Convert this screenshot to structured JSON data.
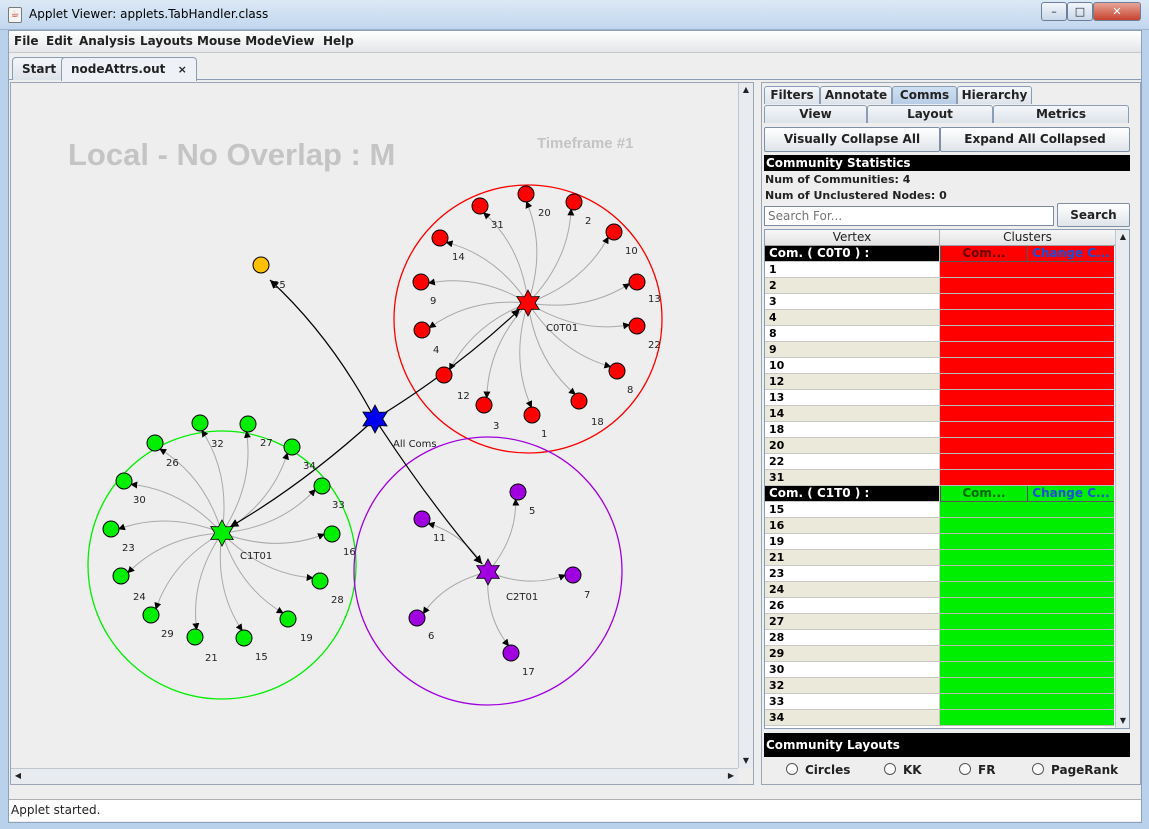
{
  "window": {
    "title": "Applet Viewer: applets.TabHandler.class",
    "icon": "java-cup-icon"
  },
  "menubar": [
    "File",
    "Edit",
    "Analysis",
    "Layouts",
    "Mouse Mode",
    "View",
    "Help"
  ],
  "doc_tabs": [
    {
      "label": "Start",
      "active": false
    },
    {
      "label": "nodeAttrs.out",
      "active": true,
      "close_glyph": "×"
    }
  ],
  "graph": {
    "title": "Local - No Overlap : M",
    "timeframe": "Timeframe #1",
    "colors": {
      "c0": "#ff0000",
      "c1": "#00ee00",
      "c2": "#a000e0",
      "hub": "#0000ee",
      "orphan": "#ffc000"
    },
    "hub_label": "All Coms",
    "orphan_label": "25",
    "communities": [
      {
        "label": "C0T01",
        "color": "#ff0000",
        "nodes": [
          "31",
          "20",
          "2",
          "10",
          "13",
          "22",
          "8",
          "18",
          "1",
          "3",
          "12",
          "4",
          "9",
          "14"
        ]
      },
      {
        "label": "C1T01",
        "color": "#00ee00",
        "nodes": [
          "32",
          "27",
          "34",
          "33",
          "16",
          "28",
          "19",
          "15",
          "21",
          "29",
          "24",
          "23",
          "30",
          "26"
        ]
      },
      {
        "label": "C2T01",
        "color": "#a000e0",
        "nodes": [
          "5",
          "7",
          "17",
          "6",
          "11"
        ]
      }
    ]
  },
  "right_panel": {
    "tabs_row1": [
      {
        "label": "Filters",
        "active": false
      },
      {
        "label": "Annotate",
        "active": false
      },
      {
        "label": "Comms",
        "active": true
      },
      {
        "label": "Hierarchy",
        "active": false
      }
    ],
    "tabs_row2": [
      "View",
      "Layout",
      "Metrics"
    ],
    "visually_collapse_label": "Visually Collapse All",
    "expand_all_label": "Expand All Collapsed",
    "stats_header": "Community Statistics",
    "num_communities": "Num of Communities: 4",
    "num_unclustered": "Num of Unclustered Nodes: 0",
    "search_placeholder": "Search For...",
    "search_button": "Search",
    "table": {
      "columns": [
        "Vertex",
        "Clusters"
      ],
      "groups": [
        {
          "label": "Com. ( C0T0 ) :",
          "btn1": "Com...",
          "btn2": "Change C...",
          "color": "#ff0000",
          "btn2_color": "#1a4fd8",
          "vertices": [
            "1",
            "2",
            "3",
            "4",
            "8",
            "9",
            "10",
            "12",
            "13",
            "14",
            "18",
            "20",
            "22",
            "31"
          ]
        },
        {
          "label": "Com. ( C1T0 ) :",
          "btn1": "Com...",
          "btn2": "Change C...",
          "color": "#00ee00",
          "btn2_color": "#1a4fd8",
          "vertices": [
            "15",
            "16",
            "19",
            "21",
            "23",
            "24",
            "26",
            "27",
            "28",
            "29",
            "30",
            "32",
            "33",
            "34"
          ]
        }
      ]
    },
    "layouts_header": "Community Layouts",
    "layout_options": [
      "Circles",
      "KK",
      "FR",
      "PageRank"
    ]
  },
  "status_text": "Applet started."
}
